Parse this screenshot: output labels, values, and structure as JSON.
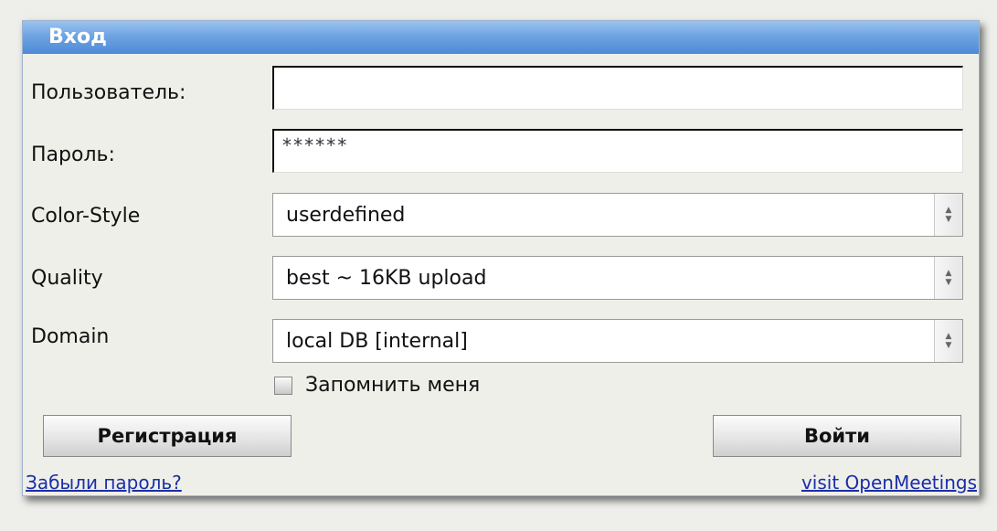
{
  "dialog": {
    "title": "Вход",
    "username": {
      "label": "Пользователь:",
      "value": ""
    },
    "password": {
      "label": "Пароль:",
      "value": "******"
    },
    "color_style": {
      "label": "Color-Style",
      "selected": "userdefined"
    },
    "quality": {
      "label": "Quality",
      "selected": "best ~ 16KB upload"
    },
    "domain": {
      "label": "Domain",
      "selected": "local DB [internal]"
    },
    "remember_me": {
      "label": "Запомнить меня",
      "checked": false
    },
    "register_button": "Регистрация",
    "login_button": "Войти",
    "forgot_password_link": "Забыли пароль?",
    "visit_link": "visit OpenMeetings"
  },
  "colors": {
    "titlebar": "#4e8ad6",
    "link": "#1a2ea8",
    "background": "#efefe9"
  }
}
